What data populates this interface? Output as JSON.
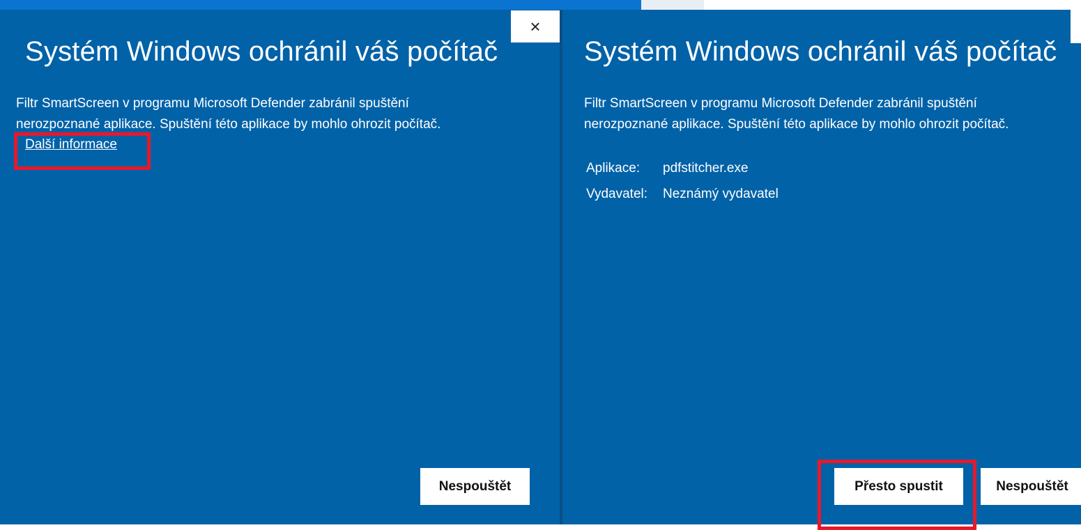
{
  "left_dialog": {
    "title": "Systém Windows ochránil váš počítač",
    "description_line1": "Filtr SmartScreen v programu Microsoft Defender zabránil spuštění",
    "description_line2": "nerozpoznané aplikace. Spuštění této aplikace by mohlo ohrozit počítač.",
    "more_info_link": "Další informace",
    "close_icon": "×",
    "dont_run_button": "Nespouštět"
  },
  "right_dialog": {
    "title": "Systém Windows ochránil váš počítač",
    "description_line1": "Filtr SmartScreen v programu Microsoft Defender zabránil spuštění",
    "description_line2": "nerozpoznané aplikace. Spuštění této aplikace by mohlo ohrozit počítač.",
    "app_label": "Aplikace:",
    "app_value": "pdfstitcher.exe",
    "publisher_label": "Vydavatel:",
    "publisher_value": "Neznámý vydavatel",
    "run_anyway_button": "Přesto spustit",
    "dont_run_button": "Nespouštět"
  },
  "colors": {
    "dialog_background": "#0262a8",
    "highlight": "#e8182a",
    "button_background": "#ffffff"
  },
  "icons": {
    "close": "close-icon"
  }
}
